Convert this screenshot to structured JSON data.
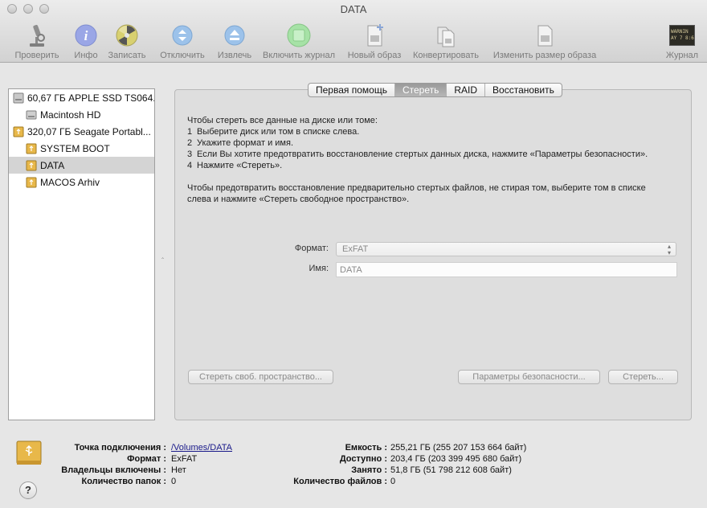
{
  "window": {
    "title": "DATA"
  },
  "toolbar": {
    "items": [
      {
        "label": "Проверить",
        "icon": "microscope-icon"
      },
      {
        "label": "Инфо",
        "icon": "info-icon"
      },
      {
        "label": "Записать",
        "icon": "burn-icon"
      },
      {
        "label": "Отключить",
        "icon": "unmount-icon"
      },
      {
        "label": "Извлечь",
        "icon": "eject-icon"
      },
      {
        "label": "Включить журнал",
        "icon": "enable-journal-icon"
      },
      {
        "label": "Новый образ",
        "icon": "new-image-icon"
      },
      {
        "label": "Конвертировать",
        "icon": "convert-icon"
      },
      {
        "label": "Изменить размер образа",
        "icon": "resize-image-icon"
      },
      {
        "label": "Журнал",
        "icon": "log-icon",
        "icon_text": "WARNIN\nAY 7 8:61"
      }
    ]
  },
  "sidebar": {
    "items": [
      {
        "label": "60,67 ГБ APPLE SSD TS064...",
        "type": "disk"
      },
      {
        "label": "Macintosh HD",
        "type": "volume"
      },
      {
        "label": "320,07 ГБ Seagate Portabl...",
        "type": "external-disk"
      },
      {
        "label": "SYSTEM BOOT",
        "type": "external-volume"
      },
      {
        "label": "DATA",
        "type": "external-volume",
        "selected": true
      },
      {
        "label": "MACOS Arhiv",
        "type": "external-volume"
      }
    ]
  },
  "tabs": [
    {
      "label": "Первая помощь",
      "active": false
    },
    {
      "label": "Стереть",
      "active": true
    },
    {
      "label": "RAID",
      "active": false
    },
    {
      "label": "Восстановить",
      "active": false
    }
  ],
  "erase": {
    "intro": "Чтобы стереть все данные на диске или томе:",
    "steps": [
      {
        "num": "1",
        "text": "Выберите диск или том в списке слева."
      },
      {
        "num": "2",
        "text": "Укажите формат и имя."
      },
      {
        "num": "3",
        "text": "Если Вы хотите предотвратить восстановление стертых данных диска, нажмите «Параметры безопасности»."
      },
      {
        "num": "4",
        "text": "Нажмите «Стереть»."
      }
    ],
    "free_space_note": "Чтобы предотвратить восстановление предварительно стертых файлов, не стирая том, выберите том в списке слева и нажмите «Стереть свободное пространство».",
    "format_label": "Формат:",
    "format_value": "ExFAT",
    "name_label": "Имя:",
    "name_value": "DATA",
    "erase_free_space_button": "Стереть своб. пространство...",
    "security_options_button": "Параметры безопасности...",
    "erase_button": "Стереть..."
  },
  "info": {
    "left": [
      {
        "key": "Точка подключения :",
        "value": "/Volumes/DATA",
        "link": true
      },
      {
        "key": "Формат :",
        "value": "ExFAT"
      },
      {
        "key": "Владельцы включены :",
        "value": "Нет"
      },
      {
        "key": "Количество папок :",
        "value": "0"
      }
    ],
    "right": [
      {
        "key": "Емкость :",
        "value": "255,21 ГБ (255 207 153 664 байт)"
      },
      {
        "key": "Доступно :",
        "value": "203,4 ГБ (203 399 495 680 байт)"
      },
      {
        "key": "Занято :",
        "value": "51,8 ГБ (51 798 212 608 байт)"
      },
      {
        "key": "Количество файлов :",
        "value": "0"
      }
    ],
    "help_label": "?"
  },
  "colors": {
    "selection": "#d4d4d4",
    "active_tab": "#a6a6a6",
    "link": "#1a1a8a",
    "usb_drive": "#e8b84a"
  }
}
